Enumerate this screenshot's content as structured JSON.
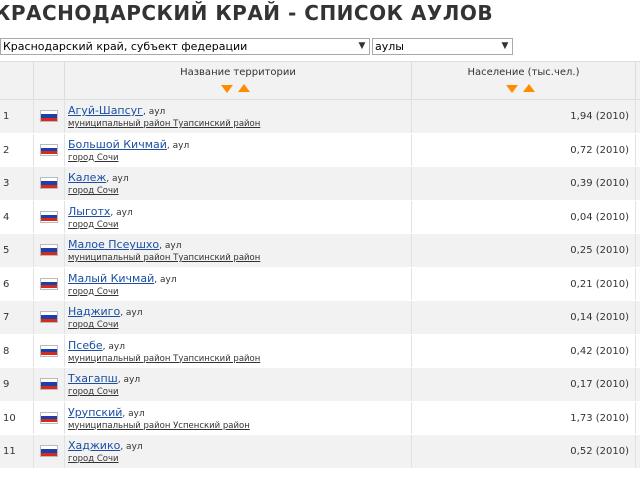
{
  "page_title": "КРАСНОДАРСКИЙ КРАЙ - СПИСОК АУЛОВ",
  "filters": {
    "region": "Краснодарский край, субъект федерации",
    "type": "аулы"
  },
  "table": {
    "headers": {
      "name": "Название территории",
      "population": "Население (тыс.чел.)"
    },
    "rows": [
      {
        "num": "1",
        "name": "Агуй-Шапсуг",
        "kind": ", аул",
        "district": "муниципальный район Туапсинский район",
        "population": "1,94 (2010)"
      },
      {
        "num": "2",
        "name": "Большой Кичмай",
        "kind": ", аул",
        "district": "город Сочи",
        "population": "0,72 (2010)"
      },
      {
        "num": "3",
        "name": "Калеж",
        "kind": ", аул",
        "district": "город Сочи",
        "population": "0,39 (2010)"
      },
      {
        "num": "4",
        "name": "Лыготх",
        "kind": ", аул",
        "district": "город Сочи",
        "population": "0,04 (2010)"
      },
      {
        "num": "5",
        "name": "Малое Псеушхо",
        "kind": ", аул",
        "district": "муниципальный район Туапсинский район",
        "population": "0,25 (2010)"
      },
      {
        "num": "6",
        "name": "Малый Кичмай",
        "kind": ", аул",
        "district": "город Сочи",
        "population": "0,21 (2010)"
      },
      {
        "num": "7",
        "name": "Наджиго",
        "kind": ", аул",
        "district": "город Сочи",
        "population": "0,14 (2010)"
      },
      {
        "num": "8",
        "name": "Псебе",
        "kind": ", аул",
        "district": "муниципальный район Туапсинский район",
        "population": "0,42 (2010)"
      },
      {
        "num": "9",
        "name": "Тхагапш",
        "kind": ", аул",
        "district": "город Сочи",
        "population": "0,17 (2010)"
      },
      {
        "num": "10",
        "name": "Урупский",
        "kind": ", аул",
        "district": "муниципальный район Успенский район",
        "population": "1,73 (2010)"
      },
      {
        "num": "11",
        "name": "Хаджико",
        "kind": ", аул",
        "district": "город Сочи",
        "population": "0,52 (2010)"
      }
    ]
  },
  "icons": {
    "flag": "russia-flag-icon",
    "sort_desc": "sort-desc-icon",
    "sort_asc": "sort-asc-icon",
    "dropdown": "chevron-down-icon"
  },
  "colors": {
    "link": "#1a4fa3",
    "sort_arrow": "#ff8c00",
    "row_alt": "#f2f2f2"
  }
}
